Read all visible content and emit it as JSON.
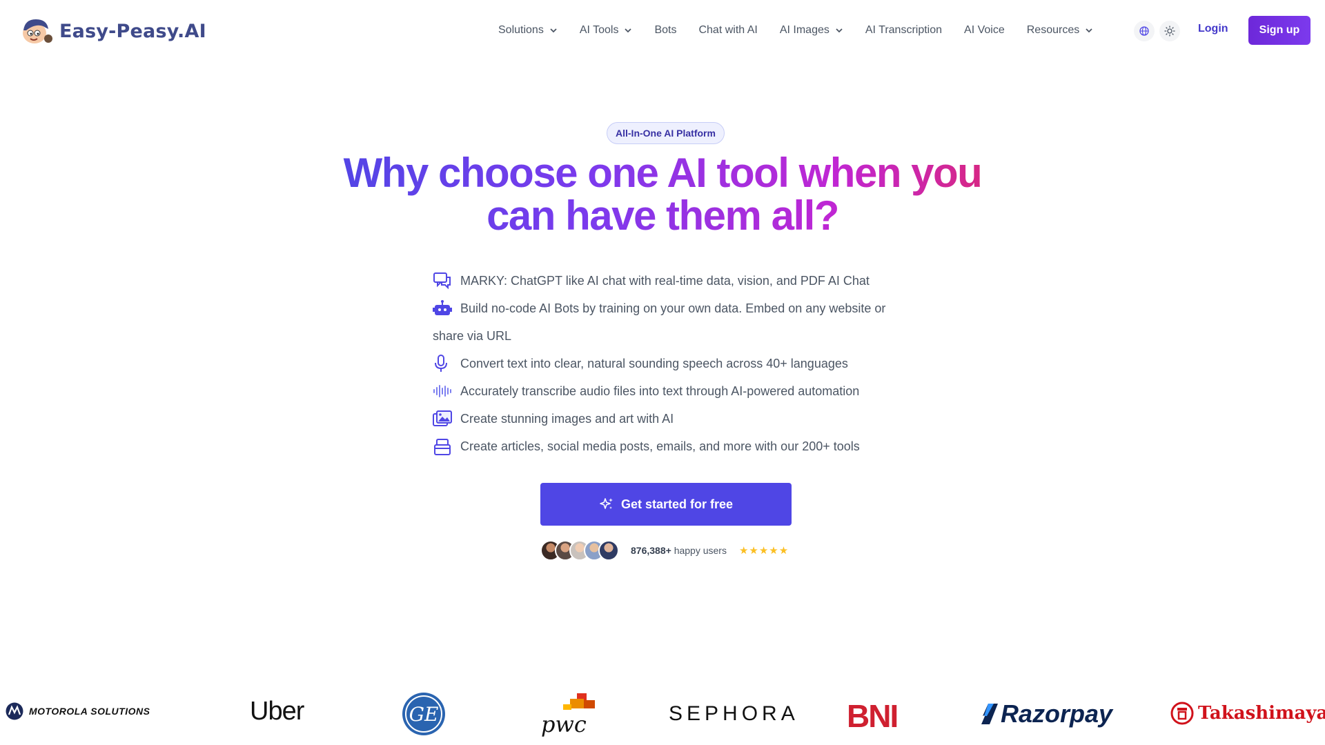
{
  "header": {
    "logo_text": "Easy-Peasy.AI",
    "nav": [
      {
        "label": "Solutions",
        "has_dropdown": true
      },
      {
        "label": "AI Tools",
        "has_dropdown": true
      },
      {
        "label": "Bots",
        "has_dropdown": false
      },
      {
        "label": "Chat with AI",
        "has_dropdown": false
      },
      {
        "label": "AI Images",
        "has_dropdown": true
      },
      {
        "label": "AI Transcription",
        "has_dropdown": false
      },
      {
        "label": "AI Voice",
        "has_dropdown": false
      },
      {
        "label": "Resources",
        "has_dropdown": true
      }
    ],
    "icons": [
      "globe-icon",
      "sun-icon"
    ],
    "login_label": "Login",
    "signup_label": "Sign up"
  },
  "hero": {
    "badge": "All-In-One AI Platform",
    "headline": "Why choose one AI tool when you can have them all?",
    "features": [
      {
        "icon": "chat-bubbles-icon",
        "text": "MARKY: ChatGPT like AI chat with real-time data, vision, and PDF AI Chat"
      },
      {
        "icon": "robot-icon",
        "text": "Build no-code AI Bots by training on your own data. Embed on any website or share via URL"
      },
      {
        "icon": "microphone-icon",
        "text": "Convert text into clear, natural sounding speech across 40+ languages"
      },
      {
        "icon": "waveform-icon",
        "text": "Accurately transcribe audio files into text through AI-powered automation"
      },
      {
        "icon": "images-icon",
        "text": "Create stunning images and art with AI"
      },
      {
        "icon": "stack-icon",
        "text": "Create articles, social media posts, emails, and more with our 200+ tools"
      }
    ],
    "cta_label": "Get started for free",
    "users_count": "876,388+",
    "users_label": "happy users",
    "rating_stars": 5
  },
  "logos": [
    "MOTOROLA SOLUTIONS",
    "Uber",
    "GE",
    "pwc",
    "SEPHORA",
    "BNI",
    "Razorpay",
    "Takashimaya"
  ],
  "colors": {
    "primary": "#4f46e5",
    "signup": "#6d28d9",
    "gradient": [
      "#4f46e5",
      "#7c3aed",
      "#c026d3",
      "#db2777"
    ],
    "stars": "#fbbf24"
  }
}
